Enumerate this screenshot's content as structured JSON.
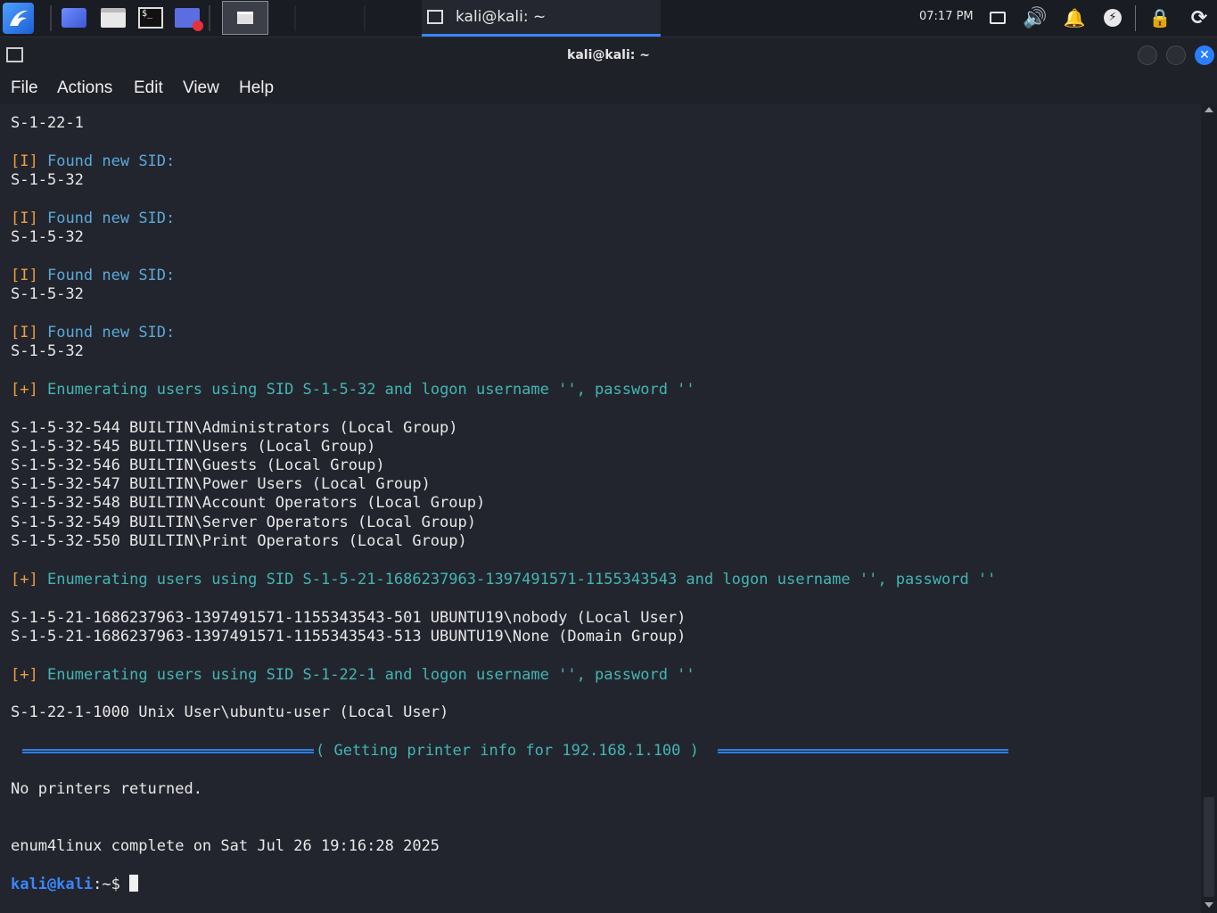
{
  "taskbar": {
    "icons": [
      "kali-menu-icon",
      "workspace-icon",
      "file-manager-icon",
      "terminal-icon",
      "screen-recorder-icon",
      "window-switcher-icon"
    ],
    "active_task": "kali@kali: ~",
    "clock": "07:17 PM",
    "tray_icons": [
      "network-icon",
      "volume-icon",
      "notification-bell-icon",
      "power-icon",
      "lock-icon",
      "logout-icon"
    ]
  },
  "window": {
    "title": "kali@kali: ~"
  },
  "menu": {
    "items": [
      "File",
      "Actions",
      "Edit",
      "View",
      "Help"
    ]
  },
  "terminal": {
    "lines": [
      "S-1-22-1",
      "[I] Found new SID:",
      "S-1-5-32",
      "[I] Found new SID:",
      "S-1-5-32",
      "[I] Found new SID:",
      "S-1-5-32",
      "[I] Found new SID:",
      "S-1-5-32",
      "[+] Enumerating users using SID S-1-5-32 and logon username '', password ''",
      "S-1-5-32-544 BUILTIN\\Administrators (Local Group)",
      "S-1-5-32-545 BUILTIN\\Users (Local Group)",
      "S-1-5-32-546 BUILTIN\\Guests (Local Group)",
      "S-1-5-32-547 BUILTIN\\Power Users (Local Group)",
      "S-1-5-32-548 BUILTIN\\Account Operators (Local Group)",
      "S-1-5-32-549 BUILTIN\\Server Operators (Local Group)",
      "S-1-5-32-550 BUILTIN\\Print Operators (Local Group)",
      "[+] Enumerating users using SID S-1-5-21-1686237963-1397491571-1155343543 and logon username '', password ''",
      "S-1-5-21-1686237963-1397491571-1155343543-501 UBUNTU19\\nobody (Local User)",
      "S-1-5-21-1686237963-1397491571-1155343543-513 UBUNTU19\\None (Domain Group)",
      "[+] Enumerating users using SID S-1-22-1 and logon username '', password ''",
      "S-1-22-1-1000 Unix User\\ubuntu-user (Local User)",
      "( Getting printer info for 192.168.1.100 )",
      "No printers returned.",
      "enum4linux complete on Sat Jul 26 19:16:28 2025"
    ],
    "prompt_user": "kali@kali",
    "prompt_path": ":~$"
  }
}
